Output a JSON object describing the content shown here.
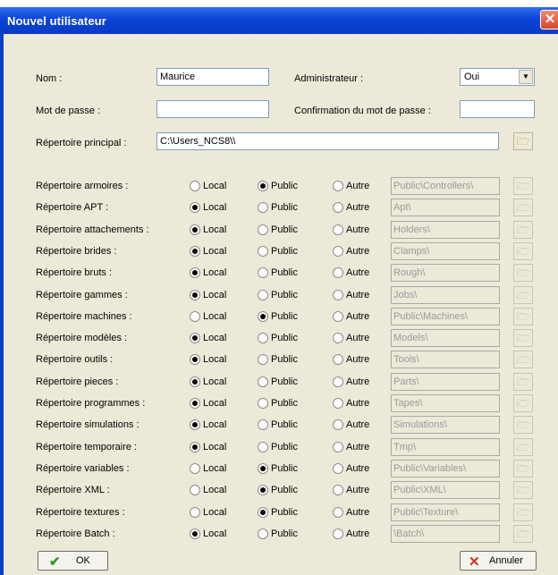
{
  "window": {
    "title": "Nouvel utilisateur",
    "close_glyph": "✕"
  },
  "fields": {
    "nom_label": "Nom :",
    "nom_value": "Maurice",
    "admin_label": "Administrateur :",
    "admin_value": "Oui",
    "mdp_label": "Mot de passe :",
    "mdp_value": "",
    "confirm_label": "Confirmation du mot de passe :",
    "confirm_value": "",
    "rep_principal_label": "Répertoire principal :",
    "rep_principal_value": "C:\\Users_NCS8\\\\"
  },
  "radio_labels": {
    "local": "Local",
    "public": "Public",
    "autre": "Autre"
  },
  "rows": [
    {
      "label": "Répertoire armoires :",
      "selected": "public",
      "path": "Public\\Controllers\\"
    },
    {
      "label": "Répertoire APT :",
      "selected": "local",
      "path": "Apt\\"
    },
    {
      "label": "Répertoire attachements :",
      "selected": "local",
      "path": "Holders\\"
    },
    {
      "label": "Répertoire brides :",
      "selected": "local",
      "path": "Clamps\\"
    },
    {
      "label": "Répertoire bruts :",
      "selected": "local",
      "path": "Rough\\"
    },
    {
      "label": "Répertoire gammes :",
      "selected": "local",
      "path": "Jobs\\"
    },
    {
      "label": "Répertoire machines :",
      "selected": "public",
      "path": "Public\\Machines\\"
    },
    {
      "label": "Répertoire modèles :",
      "selected": "local",
      "path": "Models\\"
    },
    {
      "label": "Répertoire outils :",
      "selected": "local",
      "path": "Tools\\"
    },
    {
      "label": "Répertoire pieces :",
      "selected": "local",
      "path": "Parts\\"
    },
    {
      "label": "Répertoire programmes :",
      "selected": "local",
      "path": "Tapes\\"
    },
    {
      "label": "Répertoire simulations :",
      "selected": "local",
      "path": "Simulations\\"
    },
    {
      "label": "Répertoire temporaire :",
      "selected": "local",
      "path": "Tmp\\"
    },
    {
      "label": "Répertoire variables :",
      "selected": "public",
      "path": "Public\\Variables\\"
    },
    {
      "label": "Répertoire XML :",
      "selected": "public",
      "path": "Public\\XML\\"
    },
    {
      "label": "Répertoire textures :",
      "selected": "public",
      "path": "Public\\Texture\\"
    },
    {
      "label": "Répertoire Batch :",
      "selected": "local",
      "path": "\\Batch\\"
    }
  ],
  "buttons": {
    "ok_label": "OK",
    "ok_icon": "✔",
    "cancel_label": "Annuler",
    "cancel_icon": "✕"
  },
  "icons": {
    "folder": "folder-browse-icon",
    "combo_arrow": "▼"
  },
  "colors": {
    "title_bar": "#0b44d6",
    "client_bg": "#ece9d8",
    "ok_check": "#2a9d2a",
    "cancel_x": "#d03020"
  }
}
